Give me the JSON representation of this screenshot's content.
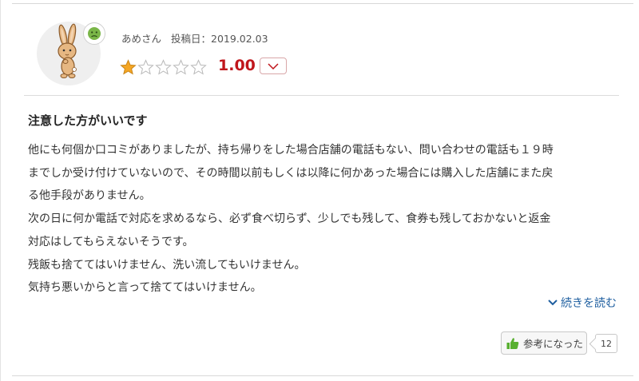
{
  "review": {
    "user_name": "あめさん",
    "date_label": "投稿日：",
    "date": "2019.02.03",
    "rating": 1.0,
    "score_text": "1.00",
    "stars_total": 5,
    "title": "注意した方がいいです",
    "body_lines": [
      "他にも何個か口コミがありましたが、持ち帰りをした場合店舗の電話もない、問い合わせの電話も１９時",
      "までしか受け付けていないので、その時間以前もしくは以降に何かあった場合には購入した店舗にまた戻",
      "る他手段がありません。",
      "次の日に何か電話で対応を求めるなら、必ず食べ切らず、少しでも残して、食券も残しておかないと返金",
      "対応はしてもらえないそうです。",
      "残飯も捨ててはいけません、洗い流してもいけません。",
      "気持ち悪いからと言って捨ててはいけません。"
    ],
    "read_more": "続きを読む",
    "helpful_label": "参考になった",
    "helpful_count": "12"
  },
  "icons": {
    "avatar": "rabbit-avatar",
    "mood": "sad-face-icon",
    "toggle": "chevron-down-icon",
    "read_more": "chevron-down-icon",
    "helpful": "thumbs-up-icon"
  },
  "colors": {
    "score": "#c0161c",
    "star_fill": "#f5a623",
    "link": "#1f5fa0",
    "thumb": "#58b030",
    "mood_face": "#7ab648"
  }
}
